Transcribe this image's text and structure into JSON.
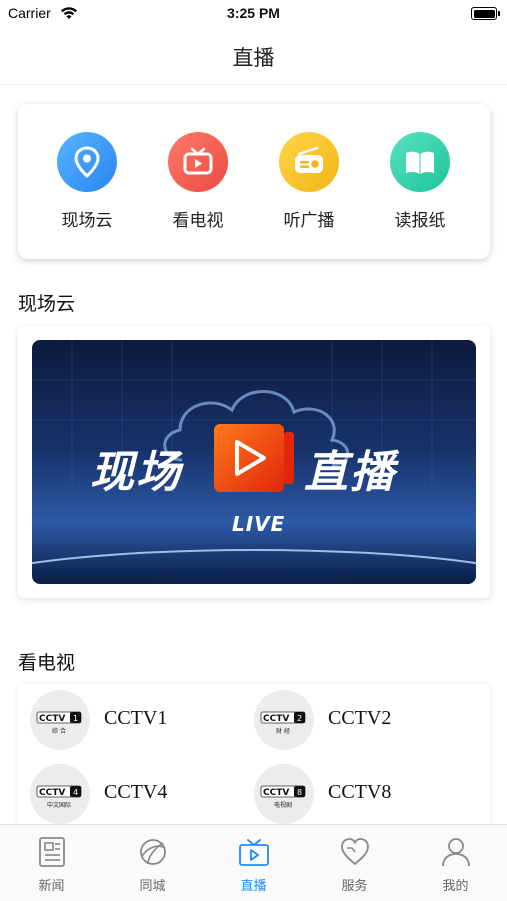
{
  "status_bar": {
    "carrier": "Carrier",
    "time": "3:25 PM"
  },
  "nav": {
    "title": "直播"
  },
  "quick_links": [
    {
      "label": "现场云",
      "icon": "location-pin-icon",
      "color": "#3a97f5"
    },
    {
      "label": "看电视",
      "icon": "tv-play-icon",
      "color": "#f25a50"
    },
    {
      "label": "听广播",
      "icon": "radio-icon",
      "color": "#f5c21b"
    },
    {
      "label": "读报纸",
      "icon": "book-icon",
      "color": "#2fcfa8"
    }
  ],
  "sections": {
    "cloud_title": "现场云",
    "tv_title": "看电视"
  },
  "banner": {
    "text_left": "现场",
    "text_right": "直播",
    "live_text": "LIVE"
  },
  "tv_channels": [
    {
      "name": "CCTV1",
      "logo_num": "1",
      "logo_sub": "综 合"
    },
    {
      "name": "CCTV2",
      "logo_num": "2",
      "logo_sub": "财 经"
    },
    {
      "name": "CCTV4",
      "logo_num": "4",
      "logo_sub": "中文国际"
    },
    {
      "name": "CCTV8",
      "logo_num": "8",
      "logo_sub": "电视剧"
    }
  ],
  "tabs": [
    {
      "label": "新闻",
      "icon": "newspaper-icon",
      "active": false
    },
    {
      "label": "同城",
      "icon": "planet-icon",
      "active": false
    },
    {
      "label": "直播",
      "icon": "tv-icon",
      "active": true
    },
    {
      "label": "服务",
      "icon": "heart-icon",
      "active": false
    },
    {
      "label": "我的",
      "icon": "person-icon",
      "active": false
    }
  ],
  "colors": {
    "accent": "#1f8ef1",
    "tab_inactive": "#888888"
  }
}
